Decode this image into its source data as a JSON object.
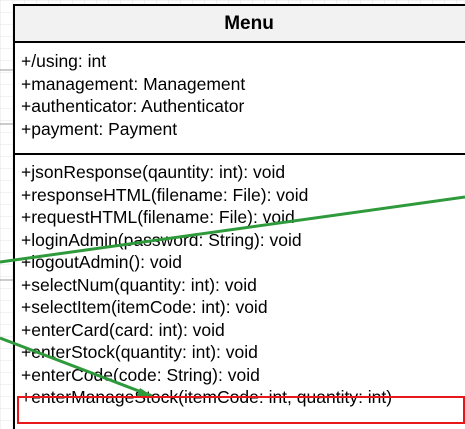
{
  "class_box": {
    "name": "Menu",
    "attributes": [
      "+/using: int",
      "+management: Management",
      "+authenticator: Authenticator",
      "+payment: Payment"
    ],
    "methods": [
      "+jsonResponse(qauntity: int): void",
      "+responseHTML(filename: File): void",
      "+requestHTML(filename: File): void",
      "+loginAdmin(password: String): void",
      "+logoutAdmin(): void",
      "+selectNum(quantity: int): void",
      "+selectItem(itemCode: int): void",
      "+enterCard(card: int): void",
      "+enterStock(quantity: int): void",
      "+enterCode(code: String): void",
      "+enterManageStock(itemCode: int, quantity: int)"
    ]
  },
  "highlighted_method": "+enterManageStock(itemCode: int, quantity: int)",
  "colors": {
    "connector": "#2f9a3b",
    "highlight": "#e8171c",
    "header_fill": "#f2f2f2",
    "background_grid": "#e6e6e6"
  }
}
